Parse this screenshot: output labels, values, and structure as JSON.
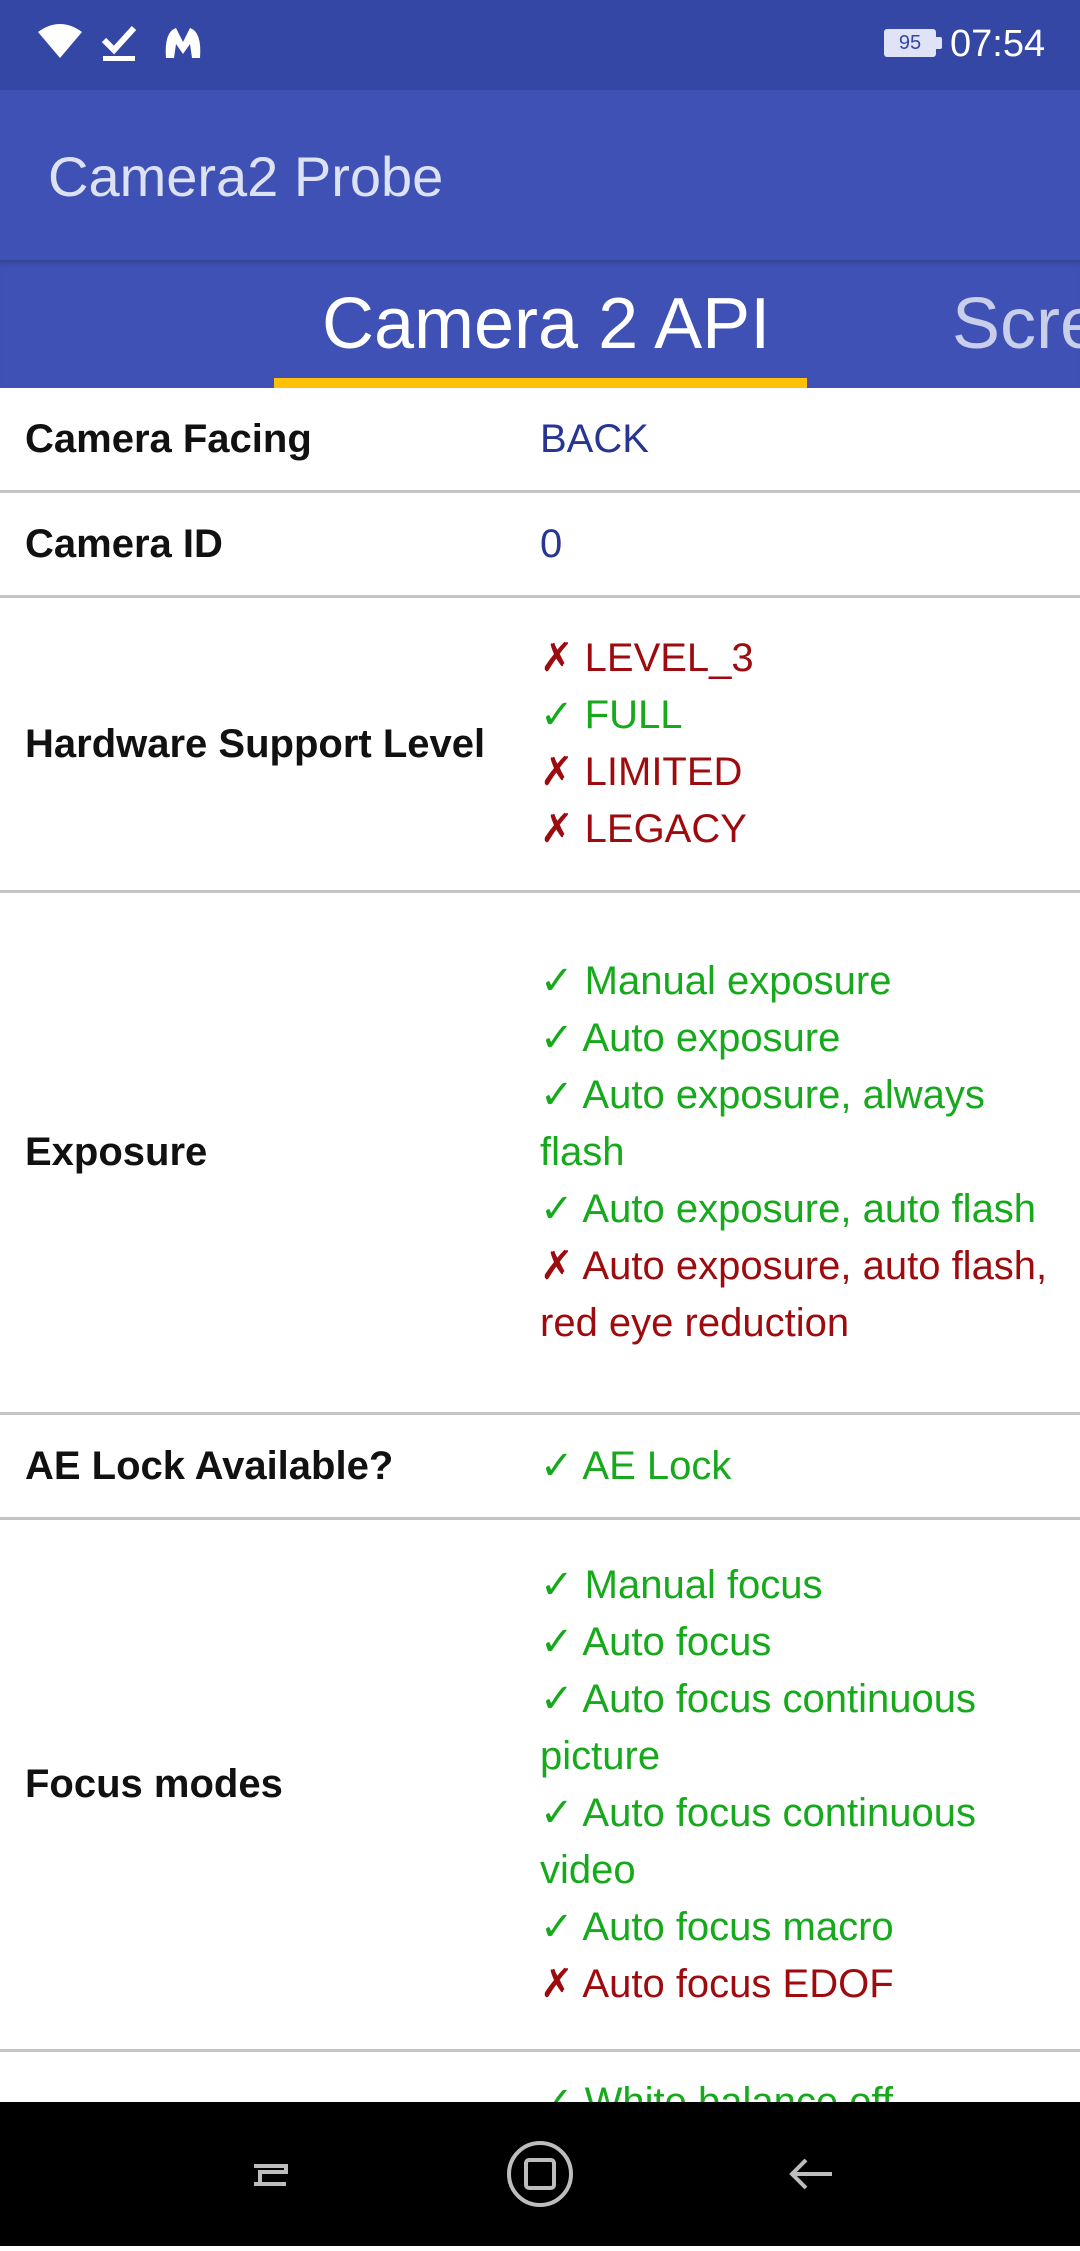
{
  "status_bar": {
    "icons": [
      "wifi-icon",
      "download-done-icon",
      "malwarebytes-icon"
    ],
    "battery": "95",
    "time": "07:54"
  },
  "app_bar": {
    "title": "Camera2 Probe"
  },
  "tabs": [
    {
      "label": "Camera 2 API",
      "selected": true
    },
    {
      "label": "Scre",
      "selected": false
    }
  ],
  "colors": {
    "status_bar": "#3447a5",
    "app_bar": "#3f51b5",
    "tab_indicator": "#ffc107",
    "supported": "#16a91c",
    "unsupported": "#9e0b0f",
    "plain_value": "#283593"
  },
  "rows": [
    {
      "label": "Camera Facing",
      "value": "BACK"
    },
    {
      "label": "Camera ID",
      "value": "0"
    },
    {
      "label": "Hardware Support Level",
      "items": [
        {
          "mark": "✗",
          "text": "LEVEL_3",
          "ok": false
        },
        {
          "mark": "✓",
          "text": "FULL",
          "ok": true
        },
        {
          "mark": "✗",
          "text": "LIMITED",
          "ok": false
        },
        {
          "mark": "✗",
          "text": "LEGACY",
          "ok": false
        }
      ]
    },
    {
      "label": "Exposure",
      "items": [
        {
          "mark": "✓",
          "text": "Manual exposure",
          "ok": true
        },
        {
          "mark": "✓",
          "text": "Auto exposure",
          "ok": true
        },
        {
          "mark": "✓",
          "text": "Auto exposure, always flash",
          "ok": true
        },
        {
          "mark": "✓",
          "text": "Auto exposure, auto flash",
          "ok": true
        },
        {
          "mark": "✗",
          "text": "Auto exposure, auto flash, red eye reduction",
          "ok": false
        }
      ]
    },
    {
      "label": "AE Lock Available?",
      "items": [
        {
          "mark": "✓",
          "text": "AE Lock",
          "ok": true
        }
      ]
    },
    {
      "label": "Focus modes",
      "items": [
        {
          "mark": "✓",
          "text": "Manual focus",
          "ok": true
        },
        {
          "mark": "✓",
          "text": "Auto focus",
          "ok": true
        },
        {
          "mark": "✓",
          "text": "Auto focus continuous picture",
          "ok": true
        },
        {
          "mark": "✓",
          "text": "Auto focus continuous video",
          "ok": true
        },
        {
          "mark": "✓",
          "text": "Auto focus macro",
          "ok": true
        },
        {
          "mark": "✗",
          "text": "Auto focus EDOF",
          "ok": false
        }
      ]
    },
    {
      "label": "",
      "items": [
        {
          "mark": "✓",
          "text": "White balance off",
          "ok": true
        }
      ]
    }
  ],
  "nav_bar": {
    "buttons": [
      "recent-apps-icon",
      "home-icon",
      "back-icon"
    ]
  }
}
